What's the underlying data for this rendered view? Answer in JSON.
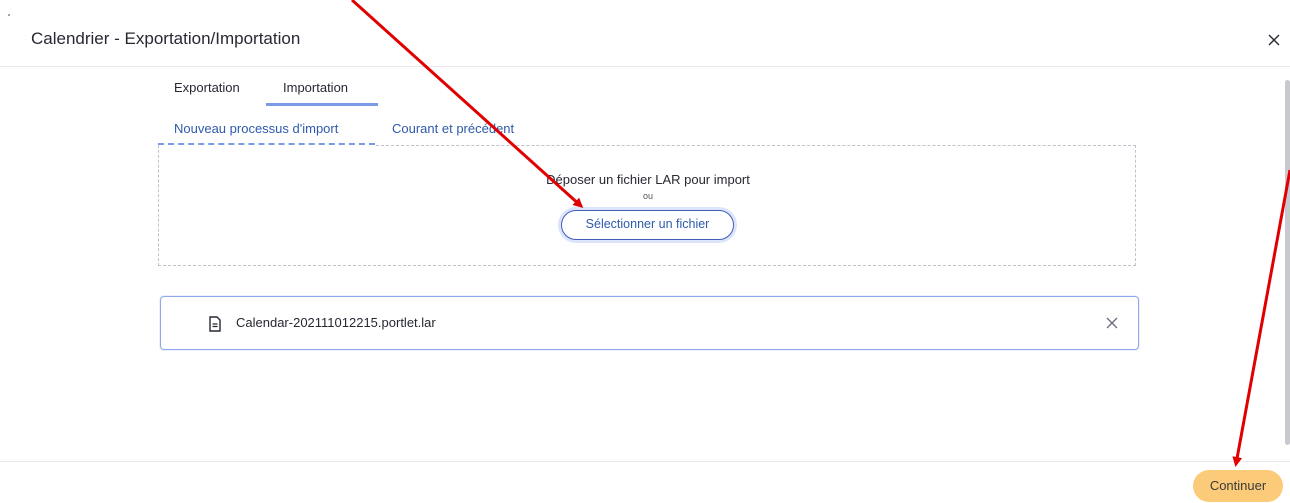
{
  "dialog": {
    "title": "Calendrier - Exportation/Importation"
  },
  "tabs": [
    {
      "label": "Exportation",
      "active": false
    },
    {
      "label": "Importation",
      "active": true
    }
  ],
  "subtabs": [
    {
      "label": "Nouveau processus d'import",
      "active": true
    },
    {
      "label": "Courant et précédent",
      "active": false
    }
  ],
  "dropzone": {
    "text": "Déposer un fichier LAR pour import",
    "or": "ou",
    "button_label": "Sélectionner un fichier"
  },
  "file": {
    "name": "Calendar-202111012215.portlet.lar",
    "icon": "file-icon",
    "remove_icon": "close-icon"
  },
  "footer": {
    "continue_label": "Continuer"
  },
  "colors": {
    "accent": "#2e5aac",
    "tab_underline": "#7a9ce8",
    "continue_bg": "#fbcb7a",
    "annotation_arrow": "#e00000"
  }
}
